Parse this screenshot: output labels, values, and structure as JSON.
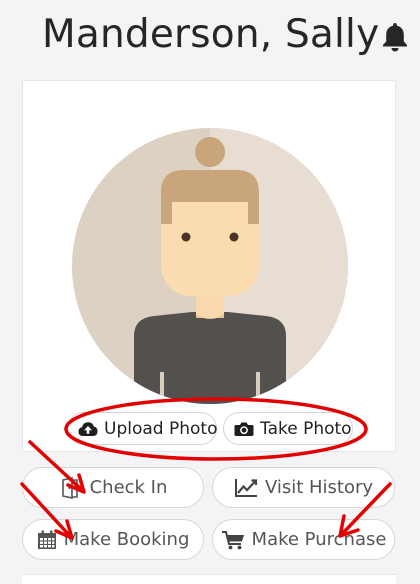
{
  "header": {
    "title": "Manderson, Sally",
    "bell_icon": "bell-icon"
  },
  "profile": {
    "avatar_icon": "person-avatar"
  },
  "photo_actions": {
    "upload_label": "Upload Photo",
    "upload_icon": "cloud-upload-icon",
    "take_label": "Take Photo",
    "take_icon": "camera-icon"
  },
  "actions": {
    "check_in": "Check In",
    "visit_history": "Visit History",
    "make_booking": "Make Booking",
    "make_purchase": "Make Purchase"
  },
  "annotation_color": "#e30000"
}
